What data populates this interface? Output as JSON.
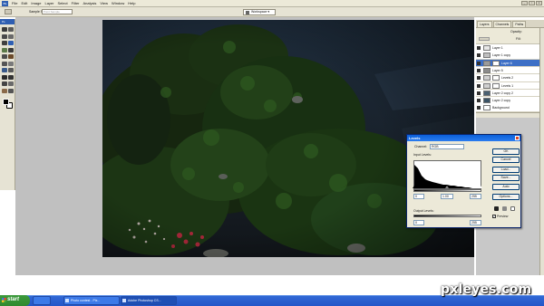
{
  "app": {
    "logo_text": "Ps",
    "menus": [
      "File",
      "Edit",
      "Image",
      "Layer",
      "Select",
      "Filter",
      "Analysis",
      "View",
      "Window",
      "Help"
    ],
    "window_controls": [
      "_",
      "▫",
      "x"
    ]
  },
  "options_bar": {
    "sample_size_label": "Sample Size:",
    "sample_size_value": "Point Sample",
    "workspace_label": "Workspace ▾"
  },
  "toolbox": {
    "header": "Ps"
  },
  "panels": {
    "tabs": [
      "Layers",
      "Channels",
      "Paths"
    ],
    "opacity_label": "Opacity:",
    "fill_label": "Fill:",
    "layers": [
      {
        "name": "Layer 1",
        "visible": true,
        "active": false,
        "thumb": "#e8e8e8",
        "has_mask": false
      },
      {
        "name": "Layer 1 copy",
        "visible": true,
        "active": false,
        "thumb": "#bfbfbf",
        "has_mask": false
      },
      {
        "name": "Layer 6",
        "visible": true,
        "active": true,
        "thumb": "#9b9b9b",
        "has_mask": true
      },
      {
        "name": "Layer 5",
        "visible": true,
        "active": false,
        "thumb": "#8c8c8c",
        "has_mask": false
      },
      {
        "name": "Levels 2",
        "visible": true,
        "active": false,
        "thumb": "#d0d0d0",
        "has_mask": true
      },
      {
        "name": "Levels 1",
        "visible": true,
        "active": false,
        "thumb": "#d0d0d0",
        "has_mask": true
      },
      {
        "name": "Layer 2 copy 2",
        "visible": true,
        "active": false,
        "thumb": "#4a6072",
        "has_mask": false
      },
      {
        "name": "Layer 2 copy",
        "visible": true,
        "active": false,
        "thumb": "#3b5366",
        "has_mask": false
      },
      {
        "name": "Background",
        "visible": true,
        "active": false,
        "thumb": "#ffffff",
        "has_mask": false
      }
    ]
  },
  "levels_dialog": {
    "title": "Levels",
    "channel_label": "Channel:",
    "channel_value": "RGB",
    "input_levels_label": "Input Levels:",
    "input_black": "0",
    "input_gamma": "1.00",
    "input_white": "255",
    "output_levels_label": "Output Levels:",
    "output_black": "0",
    "output_white": "255",
    "buttons": [
      "OK",
      "Cancel",
      "Load...",
      "Save...",
      "Auto",
      "Options..."
    ],
    "preview_label": "Preview",
    "preview_checked": true
  },
  "taskbar": {
    "start_label": "start",
    "tasks": [
      {
        "label": "Photo contest - Pix...",
        "active": false
      },
      {
        "label": "Adobe Photoshop CS...",
        "active": true
      }
    ]
  },
  "watermark": "pxleyes.com",
  "colors": {
    "xp_blue": "#2456c8",
    "selection_blue": "#3d6fc6",
    "start_green": "#2f8a2f"
  }
}
